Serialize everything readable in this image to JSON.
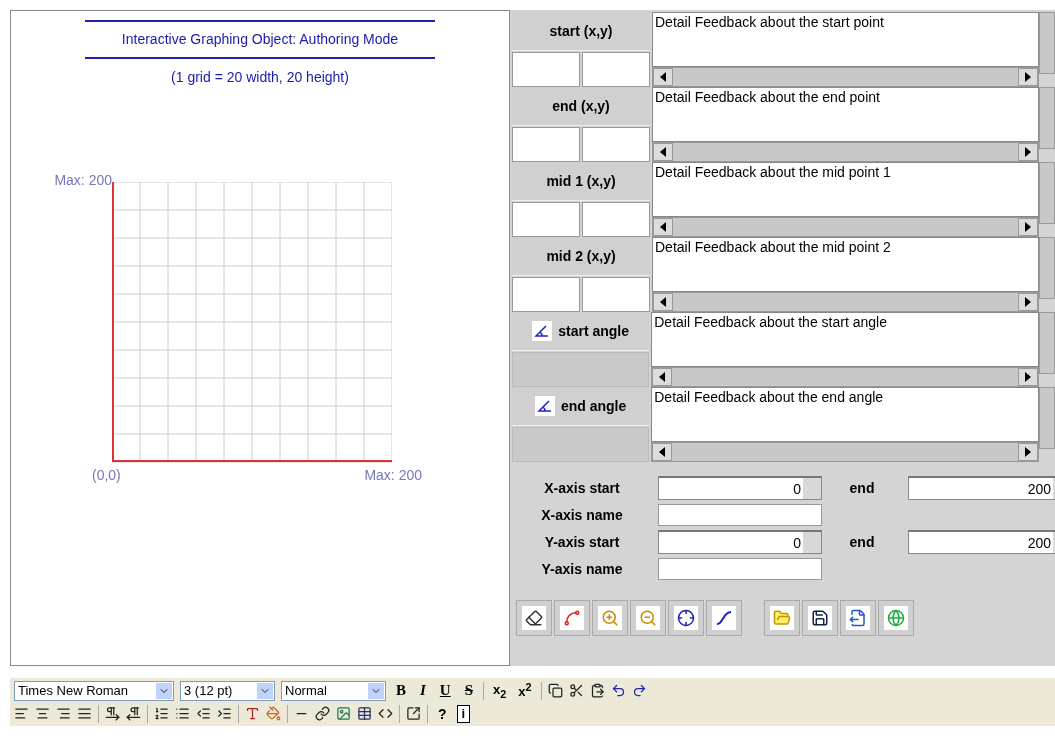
{
  "graph": {
    "title": "Interactive Graphing Object: Authoring Mode",
    "subtitle": "(1 grid = 20 width, 20 height)",
    "y_max_label": "Max: 200",
    "origin_label": "(0,0)",
    "x_max_label": "Max: 200"
  },
  "feedback_rows": [
    {
      "kind": "point",
      "label": "start (x,y)",
      "text": "Detail Feedback about the start point"
    },
    {
      "kind": "point",
      "label": "end (x,y)",
      "text": "Detail Feedback about the end point"
    },
    {
      "kind": "point",
      "label": "mid 1 (x,y)",
      "text": "Detail Feedback about the mid point 1"
    },
    {
      "kind": "point",
      "label": "mid 2 (x,y)",
      "text": "Detail Feedback about the mid point 2"
    },
    {
      "kind": "angle",
      "label": "start angle",
      "text": "Detail Feedback about the start angle"
    },
    {
      "kind": "angle",
      "label": "end angle",
      "text": "Detail Feedback about the end angle"
    }
  ],
  "axes": [
    {
      "start_label": "X-axis start",
      "start_value": "0",
      "end_label": "end",
      "end_value": "200",
      "name_label": "X-axis name"
    },
    {
      "start_label": "Y-axis start",
      "start_value": "0",
      "end_label": "end",
      "end_value": "200",
      "name_label": "Y-axis name"
    }
  ],
  "editor": {
    "font": "Times New Roman",
    "size": "3 (12 pt)",
    "format": "Normal",
    "style_buttons": [
      {
        "kind": "bold",
        "text": "B"
      },
      {
        "kind": "italic",
        "text": "I"
      },
      {
        "kind": "underline",
        "text": "U"
      },
      {
        "kind": "strike",
        "text": "S"
      }
    ],
    "script_buttons": [
      "x$_{2}$",
      "x$^{2}$"
    ],
    "help": "?",
    "info": "i"
  }
}
